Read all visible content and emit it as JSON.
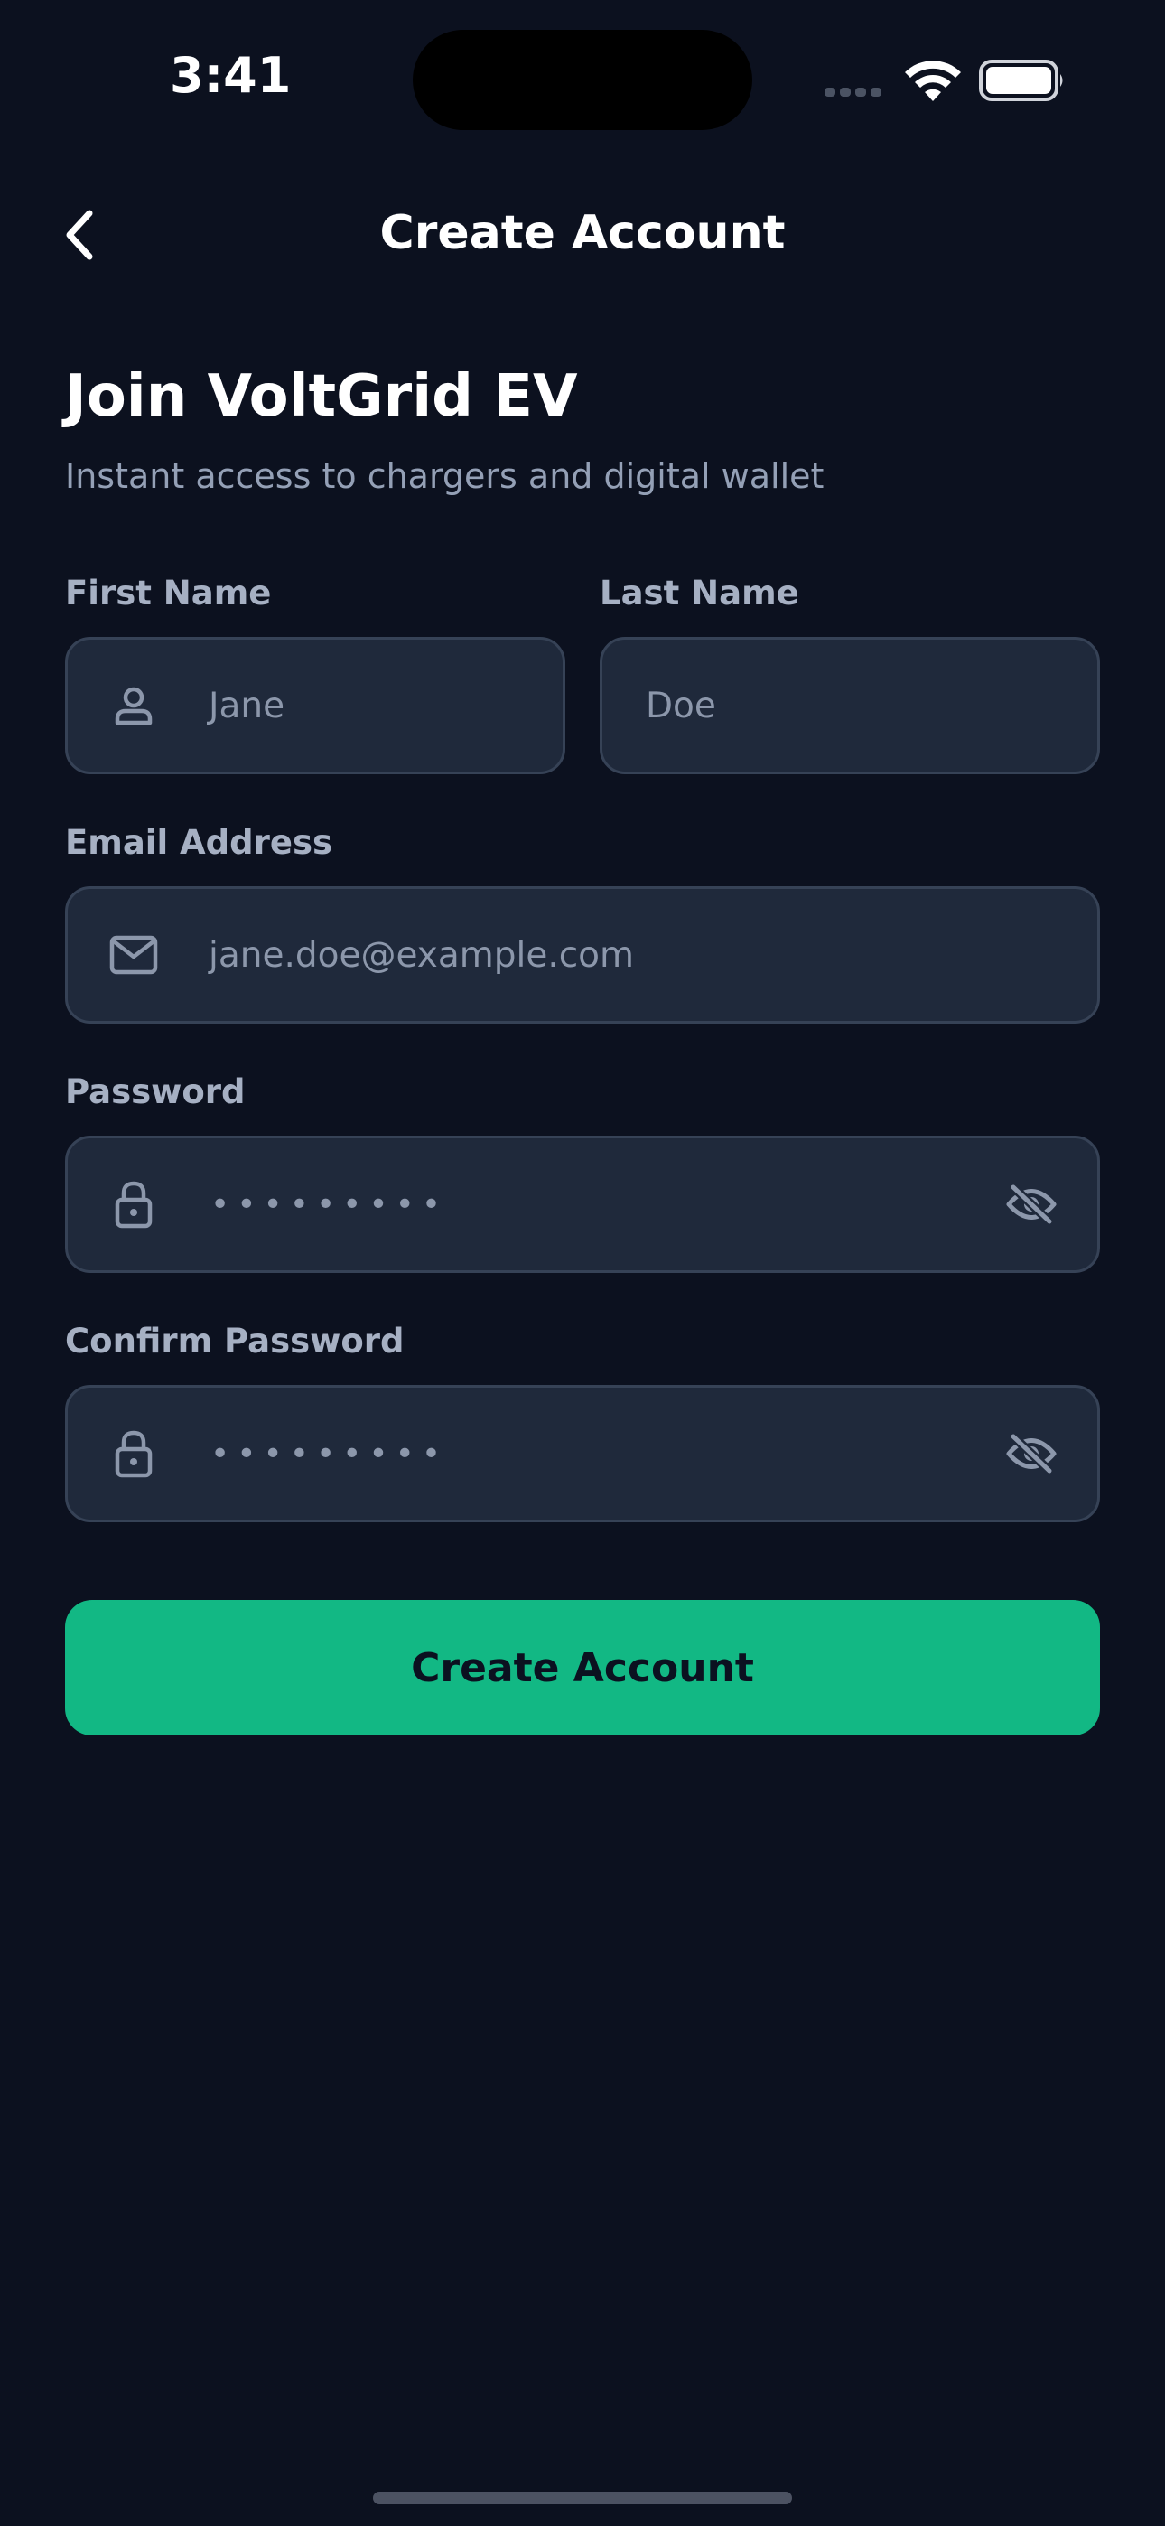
{
  "status_bar": {
    "time": "3:41",
    "signal_icon": "signal-dots-icon",
    "wifi_icon": "wifi-icon",
    "battery_icon": "battery-icon"
  },
  "nav": {
    "back_icon": "chevron-left-icon",
    "title": "Create Account"
  },
  "header": {
    "title": "Join VoltGrid EV",
    "subtitle": "Instant access to chargers and digital wallet"
  },
  "form": {
    "first_name": {
      "label": "First Name",
      "value": "Jane",
      "icon": "user-icon"
    },
    "last_name": {
      "label": "Last Name",
      "value": "Doe"
    },
    "email": {
      "label": "Email Address",
      "value": "jane.doe@example.com",
      "icon": "mail-icon"
    },
    "password": {
      "label": "Password",
      "value": "•••••••••",
      "icon": "lock-icon",
      "toggle_icon": "eye-off-icon"
    },
    "confirm_password": {
      "label": "Confirm Password",
      "value": "•••••••••",
      "icon": "lock-icon",
      "toggle_icon": "eye-off-icon"
    },
    "submit_label": "Create Account"
  },
  "colors": {
    "background": "#0c111f",
    "input_background": "#1f293b",
    "input_border": "#364256",
    "accent": "#12b884",
    "label": "#a6b0c3",
    "muted_text": "#8c97ab"
  }
}
